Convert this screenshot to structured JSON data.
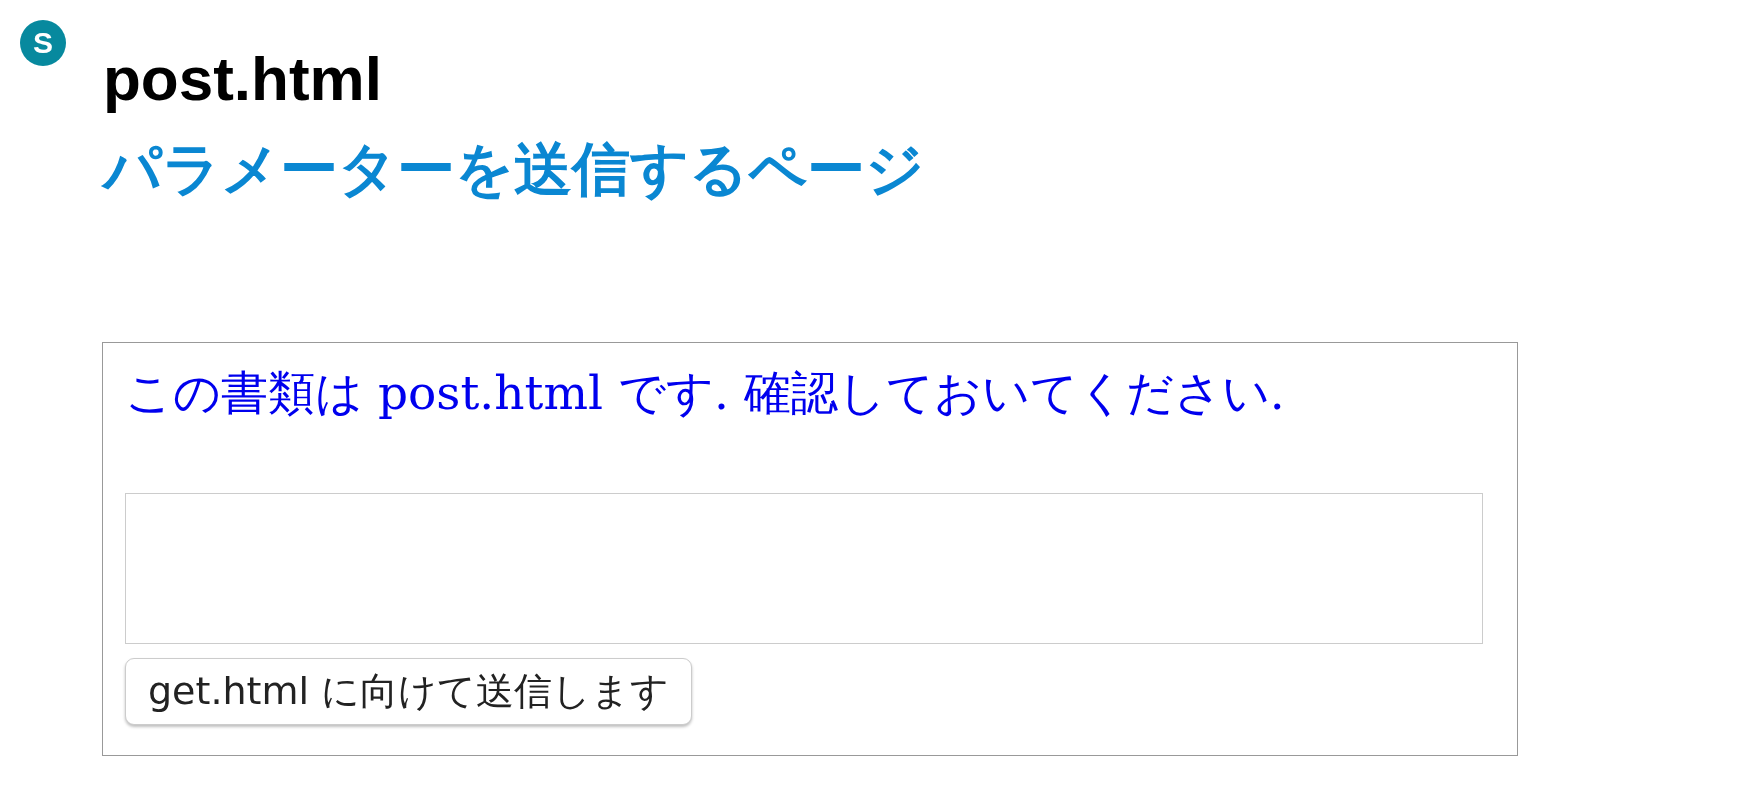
{
  "logo": {
    "letter": "S"
  },
  "title": "post.html",
  "subtitle": "パラメーターを送信するページ",
  "form": {
    "message": "この書類は post.html です. 確認しておいてください.",
    "submit": "get.html に向けて送信します"
  }
}
